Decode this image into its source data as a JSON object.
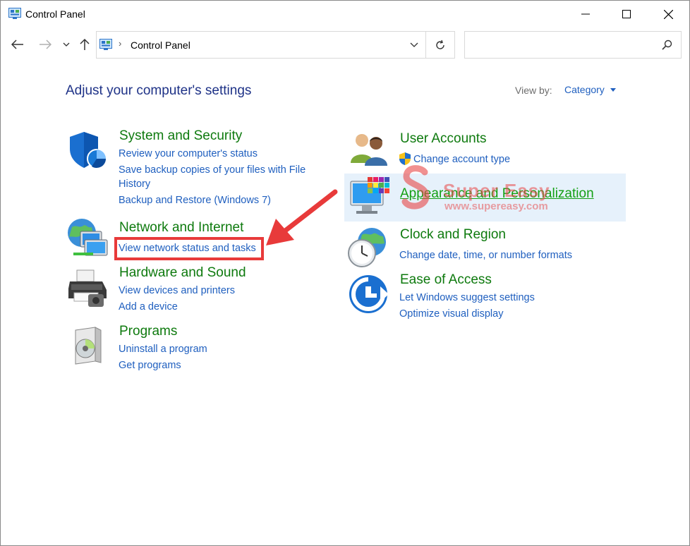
{
  "window": {
    "title": "Control Panel",
    "minimize_icon": "minimize-icon",
    "maximize_icon": "maximize-icon",
    "close_icon": "close-icon"
  },
  "navigation": {
    "back_icon": "arrow-left-icon",
    "forward_icon": "arrow-right-icon",
    "recent_icon": "chevron-down-icon",
    "up_icon": "arrow-up-icon"
  },
  "address": {
    "breadcrumb": "Control Panel",
    "refresh_icon": "refresh-icon"
  },
  "search": {
    "placeholder": "",
    "icon": "search-icon"
  },
  "page": {
    "title": "Adjust your computer's settings",
    "view_by_label": "View by:",
    "view_by_value": "Category"
  },
  "categories": {
    "system_security": {
      "title": "System and Security",
      "icon": "shield-icon",
      "links": [
        "Review your computer's status",
        "Save backup copies of your files with File",
        "History",
        "Backup and Restore (Windows 7)"
      ]
    },
    "network_internet": {
      "title": "Network and Internet",
      "icon": "network-globe-icon",
      "links": [
        "View network status and tasks"
      ]
    },
    "hardware_sound": {
      "title": "Hardware and Sound",
      "icon": "printer-icon",
      "links": [
        "View devices and printers",
        "Add a device"
      ]
    },
    "programs": {
      "title": "Programs",
      "icon": "programs-disc-icon",
      "links": [
        "Uninstall a program",
        "Get programs"
      ]
    },
    "user_accounts": {
      "title": "User Accounts",
      "icon": "users-icon",
      "links": [
        "Change account type"
      ]
    },
    "appearance": {
      "title": "Appearance and Personalization",
      "icon": "monitor-palette-icon",
      "links": []
    },
    "clock_region": {
      "title": "Clock and Region",
      "icon": "clock-globe-icon",
      "links": [
        "Change date, time, or number formats"
      ]
    },
    "ease_access": {
      "title": "Ease of Access",
      "icon": "ease-of-access-icon",
      "links": [
        "Let Windows suggest settings",
        "Optimize visual display"
      ]
    }
  },
  "watermark": {
    "brand": "Super Easy",
    "url": "www.supereasy.com"
  },
  "colors": {
    "category_green": "#0e7a0e",
    "link_blue": "#1f5fbf",
    "title_navy": "#1e3287",
    "annotation_red": "#e83a3a",
    "hover_bg": "#e6f1fb"
  }
}
